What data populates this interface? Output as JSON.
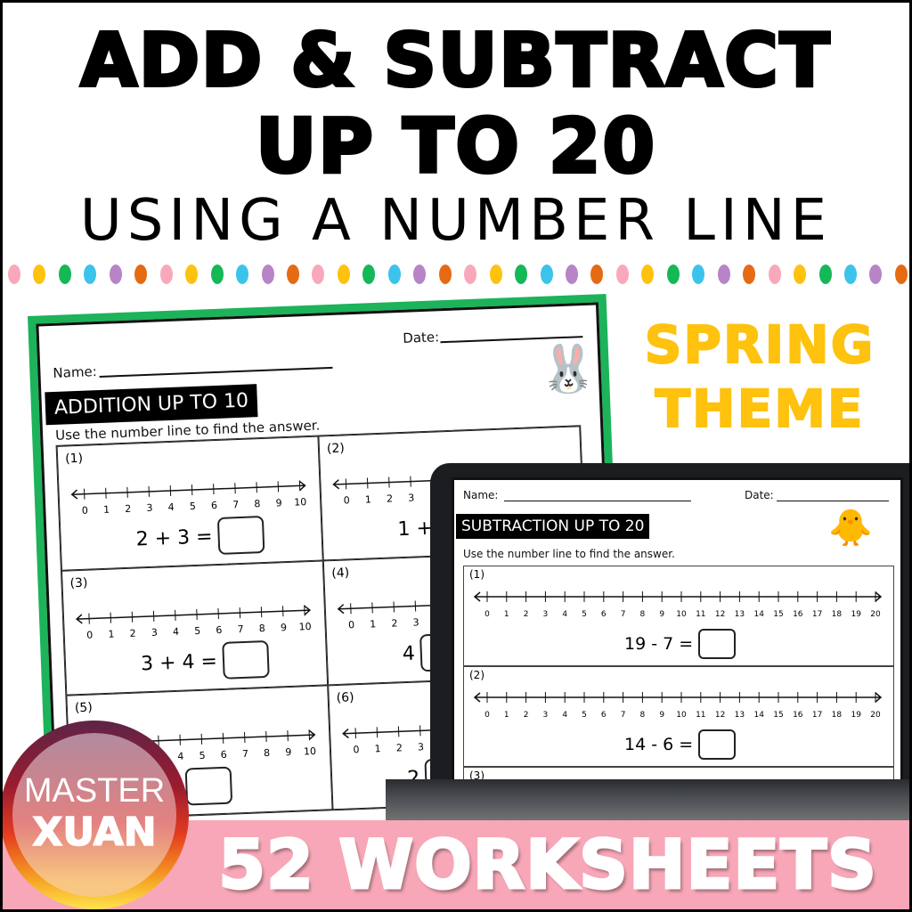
{
  "title": {
    "line1": "ADD & SUBTRACT",
    "line2": "UP TO 20",
    "line3": "USING A NUMBER LINE"
  },
  "dot_colors": [
    "#f9a8bc",
    "#fec20f",
    "#14b857",
    "#3bc3ec",
    "#b884c8",
    "#e56a14"
  ],
  "theme": {
    "line1": "SPRING",
    "line2": "THEME",
    "color": "#fec20f"
  },
  "left_sheet": {
    "name_label": "Name:",
    "date_label": "Date:",
    "title": "ADDITION UP TO 10",
    "instruction": "Use the number line to find the answer.",
    "ticks": [
      0,
      1,
      2,
      3,
      4,
      5,
      6,
      7,
      8,
      9,
      10
    ],
    "problems": [
      {
        "num": "(1)",
        "expr": "2 + 3 ="
      },
      {
        "num": "(2)",
        "expr": "1 +"
      },
      {
        "num": "(3)",
        "expr": "3 + 4 ="
      },
      {
        "num": "(4)",
        "expr": "4"
      },
      {
        "num": "(5)",
        "expr": "3 ="
      },
      {
        "num": "(6)",
        "expr": "2"
      }
    ],
    "frame_color": "#1cb35a"
  },
  "laptop_sheet": {
    "name_label": "Name:",
    "date_label": "Date:",
    "title": "SUBTRACTION UP TO 20",
    "instruction": "Use the number line to find the answer.",
    "ticks": [
      0,
      1,
      2,
      3,
      4,
      5,
      6,
      7,
      8,
      9,
      10,
      11,
      12,
      13,
      14,
      15,
      16,
      17,
      18,
      19,
      20
    ],
    "problems": [
      {
        "num": "(1)",
        "expr": "19 - 7 ="
      },
      {
        "num": "(2)",
        "expr": "14 - 6 ="
      },
      {
        "num": "(3)",
        "expr": ""
      }
    ]
  },
  "banner": {
    "text": "52 WORKSHEETS",
    "color": "#f7a7b7"
  },
  "logo": {
    "line1": "MASTER",
    "line2": "XUAN"
  }
}
